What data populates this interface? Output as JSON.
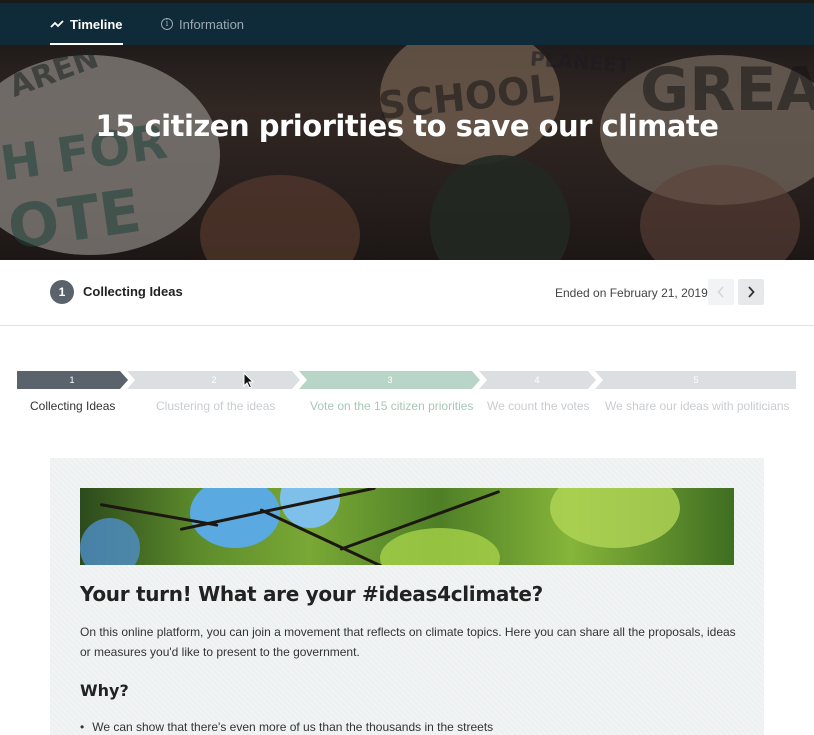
{
  "nav": {
    "tabs": [
      {
        "label": "Timeline",
        "icon": "trend-line-icon",
        "active": true
      },
      {
        "label": "Information",
        "icon": "info-icon",
        "active": false
      }
    ]
  },
  "hero": {
    "title": "15 citizen priorities to save our climate",
    "sign_texts": [
      "AREN",
      "SCHOOL",
      "GREA",
      "H FOR",
      "OTE",
      "PLANEET"
    ]
  },
  "phase": {
    "number": "1",
    "name": "Collecting Ideas",
    "status": "Ended on February 21, 2019",
    "prev_icon": "chevron-left-icon",
    "next_icon": "chevron-right-icon"
  },
  "timeline": {
    "steps": [
      {
        "num": "1",
        "label": "Collecting Ideas",
        "state": "active"
      },
      {
        "num": "2",
        "label": "Clustering of the ideas",
        "state": "upcoming"
      },
      {
        "num": "3",
        "label": "Vote on the 15 citizen priorities",
        "state": "highlight"
      },
      {
        "num": "4",
        "label": "We count the votes",
        "state": "upcoming"
      },
      {
        "num": "5",
        "label": "We share our ideas with politicians",
        "state": "upcoming"
      }
    ]
  },
  "content": {
    "heading": "Your turn! What are your #ideas4climate?",
    "intro": "On this online platform, you can join a movement that reflects on climate topics. Here you can share all the proposals, ideas or measures you'd like to present to the government.",
    "why_heading": "Why?",
    "bullets": [
      "We can show that there's even more of us than the thousands in the streets"
    ]
  },
  "colors": {
    "nav_bg": "#0f2a38",
    "step_active": "#5a626b",
    "step_upcoming": "#dcdfe1",
    "step_highlight": "#b9d5c7"
  }
}
